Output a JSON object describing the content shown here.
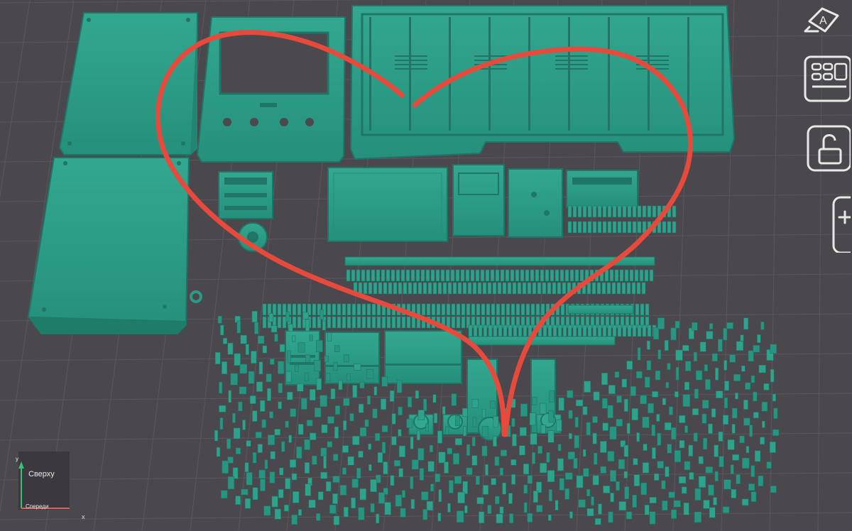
{
  "viewport": {
    "background": "#4a474d",
    "grid_color": "#5a575d",
    "part_color": "#2b9a84",
    "part_shadow": "#1f7566",
    "annotation_color": "#e64a3c"
  },
  "toolbar": {
    "tools": [
      {
        "name": "text-label-tool",
        "icon": "text-a-icon"
      },
      {
        "name": "keyboard-panel-tool",
        "icon": "panel-buttons-icon"
      },
      {
        "name": "unlock-tool",
        "icon": "padlock-open-icon"
      },
      {
        "name": "add-tool",
        "icon": "plus-icon"
      }
    ]
  },
  "axis_widget": {
    "y_label": "y",
    "top_label": "Сверху",
    "front_label": "Спереди",
    "x_label": "x"
  }
}
